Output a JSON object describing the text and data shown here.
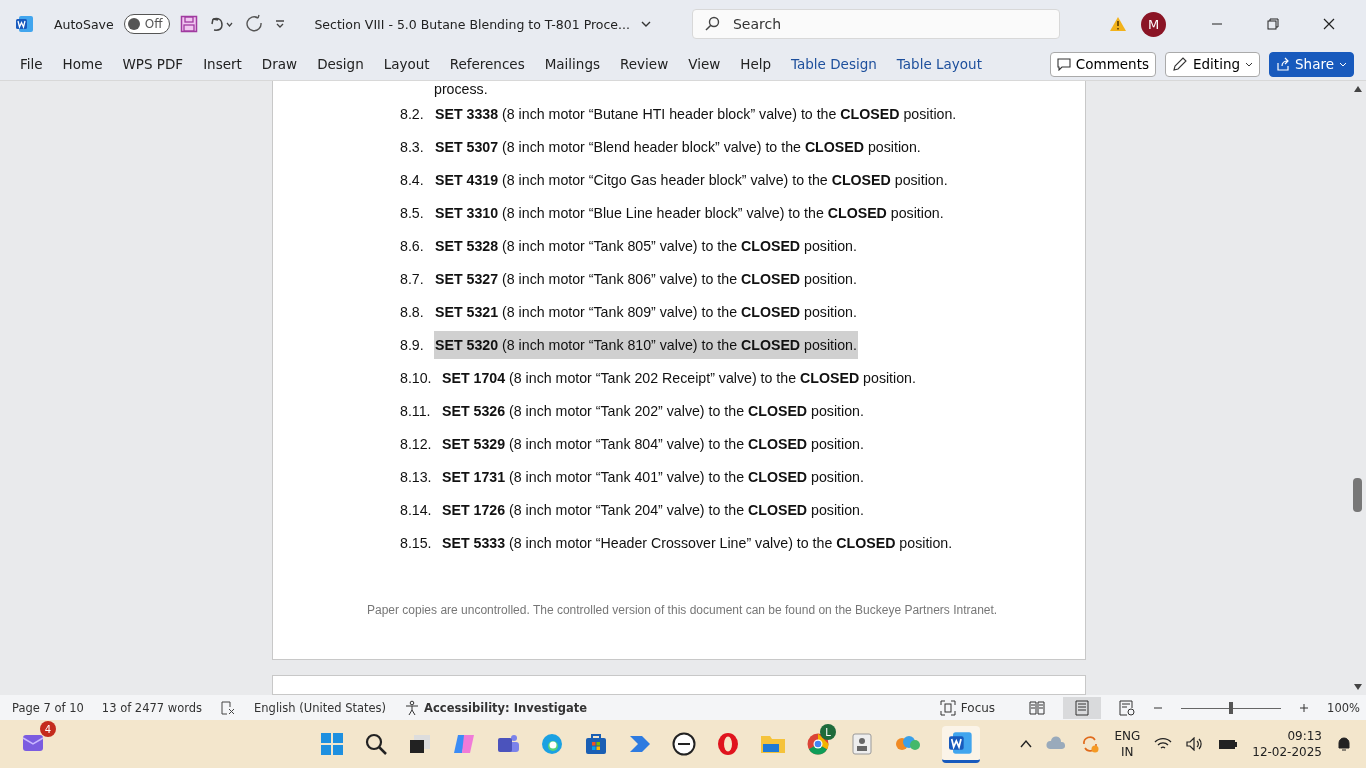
{
  "title_bar": {
    "autosave_label": "AutoSave",
    "autosave_toggle": {
      "label": "Off",
      "on": false
    },
    "document_title": "Section VIII - 5.0 Butane Blending to T-801 Proce...",
    "search": {
      "placeholder": "Search"
    },
    "avatar": "M"
  },
  "ribbon": {
    "tabs": [
      {
        "label": "File",
        "kind": "plain"
      },
      {
        "label": "Home",
        "kind": "plain"
      },
      {
        "label": "WPS PDF",
        "kind": "plain"
      },
      {
        "label": "Insert",
        "kind": "plain"
      },
      {
        "label": "Draw",
        "kind": "plain"
      },
      {
        "label": "Design",
        "kind": "plain"
      },
      {
        "label": "Layout",
        "kind": "plain"
      },
      {
        "label": "References",
        "kind": "plain"
      },
      {
        "label": "Mailings",
        "kind": "plain"
      },
      {
        "label": "Review",
        "kind": "plain"
      },
      {
        "label": "View",
        "kind": "plain"
      },
      {
        "label": "Help",
        "kind": "plain"
      },
      {
        "label": "Table Design",
        "kind": "context"
      },
      {
        "label": "Table Layout",
        "kind": "context"
      }
    ],
    "comments": "Comments",
    "editing": "Editing",
    "share": "Share"
  },
  "document": {
    "lead_text": "process.",
    "steps": [
      {
        "number": "8.2.",
        "text": "**SET 3338** (8 inch motor “Butane HTI header block” valve) to the **CLOSED** position.",
        "selected": false
      },
      {
        "number": "8.3.",
        "text": "**SET 5307** (8 inch motor “Blend header block” valve) to the **CLOSED** position.",
        "selected": false
      },
      {
        "number": "8.4.",
        "text": "**SET 4319** (8 inch motor “Citgo Gas header block” valve) to the **CLOSED** position.",
        "selected": false
      },
      {
        "number": "8.5.",
        "text": "**SET 3310** (8 inch motor “Blue Line header block” valve) to the **CLOSED** position.",
        "selected": false
      },
      {
        "number": "8.6.",
        "text": "**SET 5328** (8 inch motor “Tank 805” valve) to the **CLOSED** position.",
        "selected": false
      },
      {
        "number": "8.7.",
        "text": "**SET 5327** (8 inch motor “Tank 806” valve) to the **CLOSED** position.",
        "selected": false
      },
      {
        "number": "8.8.",
        "text": "**SET 5321** (8 inch motor “Tank 809” valve) to the **CLOSED** position.",
        "selected": false
      },
      {
        "number": "8.9.",
        "text": "**SET 5320** (8 inch motor “Tank 810” valve) to the **CLOSED** position.",
        "selected": true
      },
      {
        "number": "8.10.",
        "text": "**SET 1704** (8 inch motor “Tank 202 Receipt” valve) to the **CLOSED** position.",
        "selected": false
      },
      {
        "number": "8.11.",
        "text": "**SET 5326** (8 inch motor “Tank 202” valve) to the **CLOSED** position.",
        "selected": false
      },
      {
        "number": "8.12.",
        "text": "**SET 5329** (8 inch motor “Tank 804” valve) to the **CLOSED** position.",
        "selected": false
      },
      {
        "number": "8.13.",
        "text": "**SET 1731** (8 inch motor “Tank 401” valve) to the **CLOSED** position.",
        "selected": false
      },
      {
        "number": "8.14.",
        "text": "**SET 1726** (8 inch motor “Tank 204” valve) to the **CLOSED** position.",
        "selected": false
      },
      {
        "number": "8.15.",
        "text": "**SET 5333** (8 inch motor “Header Crossover Line” valve) to the **CLOSED** position.",
        "selected": false
      }
    ],
    "footer": "Paper copies are uncontrolled. The controlled version of this document can be found on the Buckeye Partners Intranet."
  },
  "status_bar": {
    "page": "Page 7 of 10",
    "words": "13 of 2477 words",
    "language": "English (United States)",
    "accessibility": "Accessibility: Investigate",
    "focus": "Focus",
    "zoom_slider": {
      "level": 0.5
    },
    "zoom": "100%"
  },
  "taskbar": {
    "mail_badge": "4",
    "chrome_badge": "L",
    "language": "ENG",
    "region": "IN",
    "time": "09:13",
    "date": "12-02-2025"
  }
}
